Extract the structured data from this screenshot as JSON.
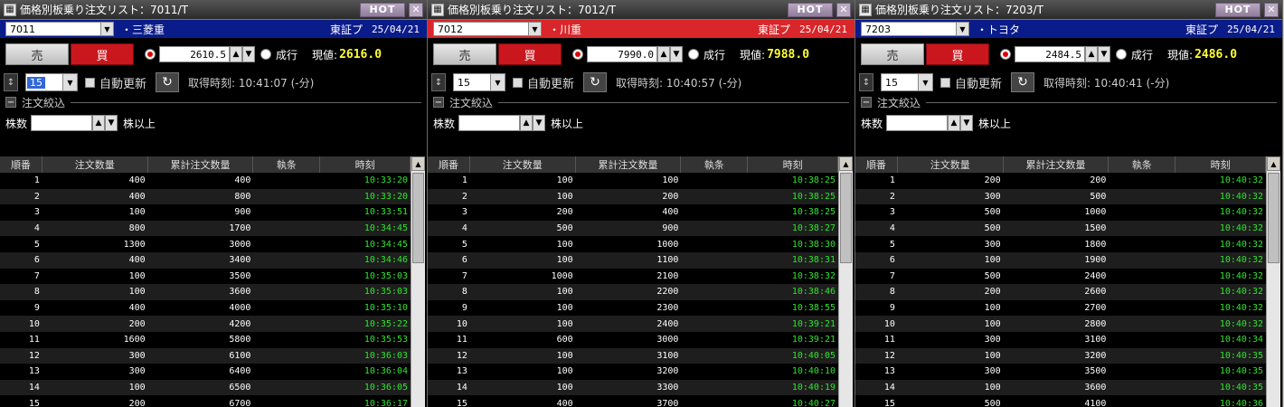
{
  "panels": [
    {
      "title": "価格別板乗り注文リスト：7011/T",
      "hot": "HOT",
      "code": "7011",
      "name": "・三菱重",
      "market": "東証プ",
      "date": "25/04/21",
      "code_bar_color": "#0a1b8a",
      "sell_label": "売",
      "buy_label": "買",
      "price": "2610.5",
      "market_order_label": "成行",
      "current_label": "現値:",
      "current_value": "2616.0",
      "count": "15",
      "auto_update_label": "自動更新",
      "fetched_label": "取得時刻: 10:41:07 (-分)",
      "filter_label": "注文絞込",
      "shares_label": "株数",
      "shares_or_more": "株以上",
      "columns": [
        "順番",
        "注文数量",
        "累計注文数量",
        "執条",
        "時刻"
      ],
      "rows": [
        [
          "1",
          "400",
          "400",
          "",
          "10:33:20"
        ],
        [
          "2",
          "400",
          "800",
          "",
          "10:33:20"
        ],
        [
          "3",
          "100",
          "900",
          "",
          "10:33:51"
        ],
        [
          "4",
          "800",
          "1700",
          "",
          "10:34:45"
        ],
        [
          "5",
          "1300",
          "3000",
          "",
          "10:34:45"
        ],
        [
          "6",
          "400",
          "3400",
          "",
          "10:34:46"
        ],
        [
          "7",
          "100",
          "3500",
          "",
          "10:35:03"
        ],
        [
          "8",
          "100",
          "3600",
          "",
          "10:35:03"
        ],
        [
          "9",
          "400",
          "4000",
          "",
          "10:35:10"
        ],
        [
          "10",
          "200",
          "4200",
          "",
          "10:35:22"
        ],
        [
          "11",
          "1600",
          "5800",
          "",
          "10:35:53"
        ],
        [
          "12",
          "300",
          "6100",
          "",
          "10:36:03"
        ],
        [
          "13",
          "300",
          "6400",
          "",
          "10:36:04"
        ],
        [
          "14",
          "100",
          "6500",
          "",
          "10:36:05"
        ],
        [
          "15",
          "200",
          "6700",
          "",
          "10:36:17"
        ]
      ]
    },
    {
      "title": "価格別板乗り注文リスト：7012/T",
      "hot": "HOT",
      "code": "7012",
      "name": "・川重",
      "market": "東証プ",
      "date": "25/04/21",
      "code_bar_color": "#d8262a",
      "sell_label": "売",
      "buy_label": "買",
      "price": "7990.0",
      "market_order_label": "成行",
      "current_label": "現値:",
      "current_value": "7988.0",
      "count": "15",
      "auto_update_label": "自動更新",
      "fetched_label": "取得時刻: 10:40:57 (-分)",
      "filter_label": "注文絞込",
      "shares_label": "株数",
      "shares_or_more": "株以上",
      "columns": [
        "順番",
        "注文数量",
        "累計注文数量",
        "執条",
        "時刻"
      ],
      "rows": [
        [
          "1",
          "100",
          "100",
          "",
          "10:38:25"
        ],
        [
          "2",
          "100",
          "200",
          "",
          "10:38:25"
        ],
        [
          "3",
          "200",
          "400",
          "",
          "10:38:25"
        ],
        [
          "4",
          "500",
          "900",
          "",
          "10:38:27"
        ],
        [
          "5",
          "100",
          "1000",
          "",
          "10:38:30"
        ],
        [
          "6",
          "100",
          "1100",
          "",
          "10:38:31"
        ],
        [
          "7",
          "1000",
          "2100",
          "",
          "10:38:32"
        ],
        [
          "8",
          "100",
          "2200",
          "",
          "10:38:46"
        ],
        [
          "9",
          "100",
          "2300",
          "",
          "10:38:55"
        ],
        [
          "10",
          "100",
          "2400",
          "",
          "10:39:21"
        ],
        [
          "11",
          "600",
          "3000",
          "",
          "10:39:21"
        ],
        [
          "12",
          "100",
          "3100",
          "",
          "10:40:05"
        ],
        [
          "13",
          "100",
          "3200",
          "",
          "10:40:10"
        ],
        [
          "14",
          "100",
          "3300",
          "",
          "10:40:19"
        ],
        [
          "15",
          "400",
          "3700",
          "",
          "10:40:27"
        ]
      ]
    },
    {
      "title": "価格別板乗り注文リスト：7203/T",
      "hot": "HOT",
      "code": "7203",
      "name": "・トヨタ",
      "market": "東証プ",
      "date": "25/04/21",
      "code_bar_color": "#0a1b8a",
      "sell_label": "売",
      "buy_label": "買",
      "price": "2484.5",
      "market_order_label": "成行",
      "current_label": "現値:",
      "current_value": "2486.0",
      "count": "15",
      "auto_update_label": "自動更新",
      "fetched_label": "取得時刻: 10:40:41 (-分)",
      "filter_label": "注文絞込",
      "shares_label": "株数",
      "shares_or_more": "株以上",
      "columns": [
        "順番",
        "注文数量",
        "累計注文数量",
        "執条",
        "時刻"
      ],
      "rows": [
        [
          "1",
          "200",
          "200",
          "",
          "10:40:32"
        ],
        [
          "2",
          "300",
          "500",
          "",
          "10:40:32"
        ],
        [
          "3",
          "500",
          "1000",
          "",
          "10:40:32"
        ],
        [
          "4",
          "500",
          "1500",
          "",
          "10:40:32"
        ],
        [
          "5",
          "300",
          "1800",
          "",
          "10:40:32"
        ],
        [
          "6",
          "100",
          "1900",
          "",
          "10:40:32"
        ],
        [
          "7",
          "500",
          "2400",
          "",
          "10:40:32"
        ],
        [
          "8",
          "200",
          "2600",
          "",
          "10:40:32"
        ],
        [
          "9",
          "100",
          "2700",
          "",
          "10:40:32"
        ],
        [
          "10",
          "100",
          "2800",
          "",
          "10:40:32"
        ],
        [
          "11",
          "300",
          "3100",
          "",
          "10:40:34"
        ],
        [
          "12",
          "100",
          "3200",
          "",
          "10:40:35"
        ],
        [
          "13",
          "300",
          "3500",
          "",
          "10:40:35"
        ],
        [
          "14",
          "100",
          "3600",
          "",
          "10:40:35"
        ],
        [
          "15",
          "500",
          "4100",
          "",
          "10:40:36"
        ]
      ]
    }
  ]
}
